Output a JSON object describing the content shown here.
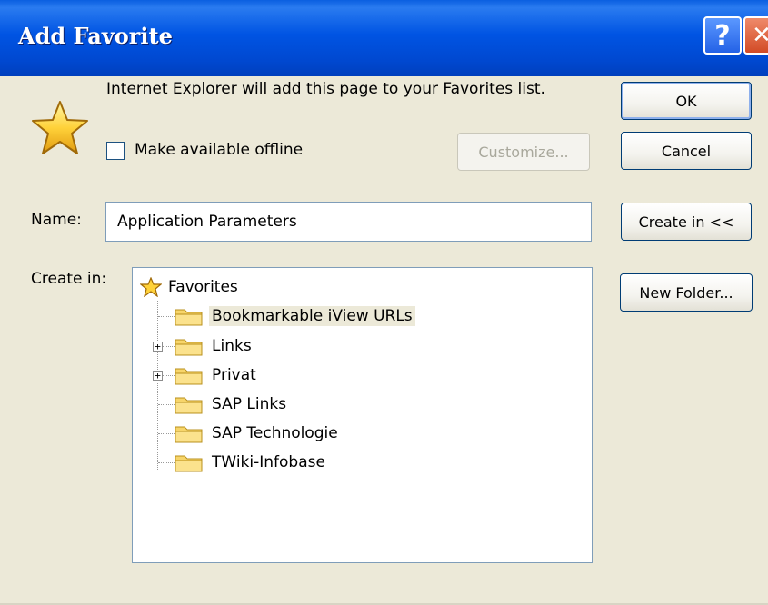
{
  "window": {
    "title": "Add Favorite",
    "help_glyph": "?",
    "close_glyph": "✕"
  },
  "message": "Internet Explorer will add this page to your Favorites list.",
  "offline": {
    "label": "Make available offline",
    "checked": false
  },
  "buttons": {
    "ok": "OK",
    "cancel": "Cancel",
    "customize": "Customize...",
    "create_in": "Create in <<",
    "new_folder": "New Folder..."
  },
  "name_field": {
    "label": "Name:",
    "value": "Application Parameters"
  },
  "create_in_label": "Create in:",
  "tree": {
    "root": "Favorites",
    "items": [
      {
        "label": "Bookmarkable iView URLs",
        "expandable": false,
        "selected": true
      },
      {
        "label": "Links",
        "expandable": true,
        "selected": false
      },
      {
        "label": "Privat",
        "expandable": true,
        "selected": false
      },
      {
        "label": "SAP Links",
        "expandable": false,
        "selected": false
      },
      {
        "label": "SAP Technologie",
        "expandable": false,
        "selected": false
      },
      {
        "label": "TWiki-Infobase",
        "expandable": false,
        "selected": false
      }
    ]
  },
  "icons": {
    "big_star": "favorites-star-icon",
    "folder": "folder-icon",
    "expand": "plus-expander-icon"
  },
  "colors": {
    "titlebar": "#0054e3",
    "dialog_bg": "#ece9d8",
    "star": "#ffd23a",
    "folder": "#f7d56a"
  }
}
